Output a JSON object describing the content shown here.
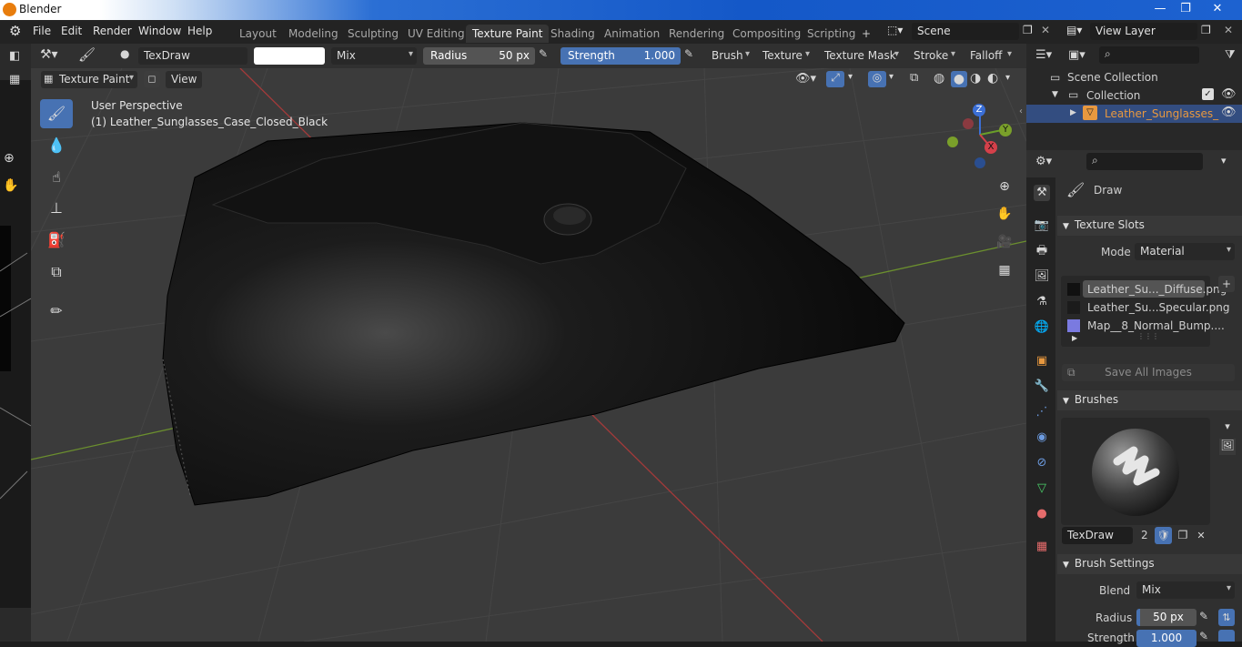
{
  "window": {
    "title": "Blender",
    "min": "—",
    "max": "❐",
    "close": "✕"
  },
  "menus": [
    "File",
    "Edit",
    "Render",
    "Window",
    "Help"
  ],
  "workspaces": [
    "Layout",
    "Modeling",
    "Sculpting",
    "UV Editing",
    "Texture Paint",
    "Shading",
    "Animation",
    "Rendering",
    "Compositing",
    "Scripting"
  ],
  "active_workspace": "Texture Paint",
  "plus": "+",
  "scene": "Scene",
  "view_layer": "View Layer",
  "toolheader": {
    "brush_name": "TexDraw",
    "blend": "Mix",
    "radius_label": "Radius",
    "radius_value": "50 px",
    "strength_label": "Strength",
    "strength_value": "1.000",
    "brush": "Brush",
    "texture": "Texture",
    "texture_mask": "Texture Mask",
    "stroke": "Stroke",
    "falloff": "Falloff"
  },
  "viewport_header": {
    "mode": "Texture Paint",
    "view": "View"
  },
  "viewport": {
    "perspective": "User Perspective",
    "object": "(1) Leather_Sunglasses_Case_Closed_Black",
    "axis_x": "X",
    "axis_y": "Y",
    "axis_z": "Z"
  },
  "outliner": {
    "scene_collection": "Scene Collection",
    "collection": "Collection",
    "object": "Leather_Sunglasses_"
  },
  "props": {
    "tool_name": "Draw",
    "texture_slots": {
      "title": "Texture Slots",
      "mode_label": "Mode",
      "mode_value": "Material",
      "slots": [
        "Leather_Su..._Diffuse.png",
        "Leather_Su...Specular.png",
        "Map__8_Normal_Bump...."
      ],
      "save_all": "Save All Images"
    },
    "brushes": {
      "title": "Brushes",
      "brush_name": "TexDraw",
      "users": "2"
    },
    "brush_settings": {
      "title": "Brush Settings",
      "blend_label": "Blend",
      "blend_value": "Mix",
      "radius_label": "Radius",
      "radius_value": "50 px",
      "strength_label": "Strength",
      "strength_value": "1.000"
    }
  },
  "colors": {
    "accent": "#4772b3",
    "active_text": "#e8983f",
    "bg": "#303030"
  }
}
